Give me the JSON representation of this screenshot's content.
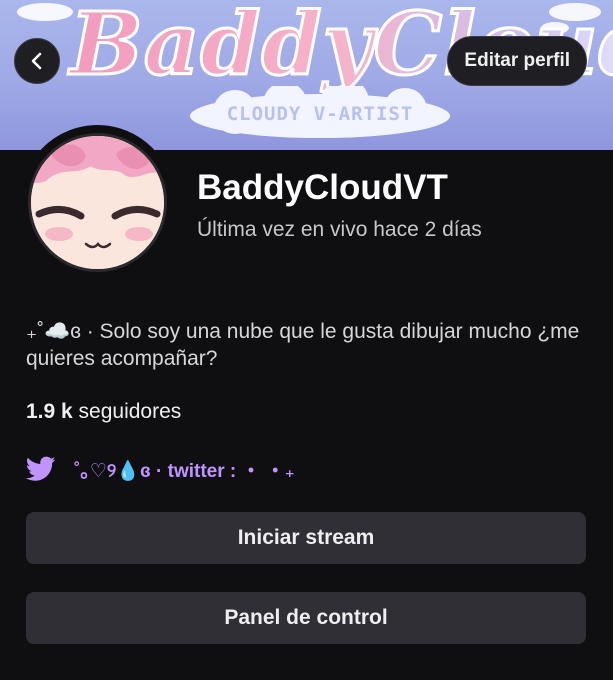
{
  "banner": {
    "title": "BaddyCloud",
    "subtitle": "CLOUDY V-ARTIST"
  },
  "header": {
    "back_icon": "chevron-left-icon",
    "edit_label": "Editar perfil"
  },
  "profile": {
    "username": "BaddyCloudVT",
    "last_live": "Última vez en vivo hace 2 días",
    "bio": "₊˚☁️ɞ · Solo soy una nube que le gusta dibujar mucho ¿me quieres acompañar?",
    "followers_count": "1.9 k",
    "followers_label": " seguidores"
  },
  "social": {
    "icon": "twitter-bird-icon",
    "handle": "˚｡♡୨💧ɞ · twitter : ・ ・₊"
  },
  "actions": {
    "start_stream": "Iniciar stream",
    "control_panel": "Panel de control"
  },
  "colors": {
    "accent": "#bf94ff",
    "background": "#0f0e11",
    "button": "#2f2f35"
  }
}
